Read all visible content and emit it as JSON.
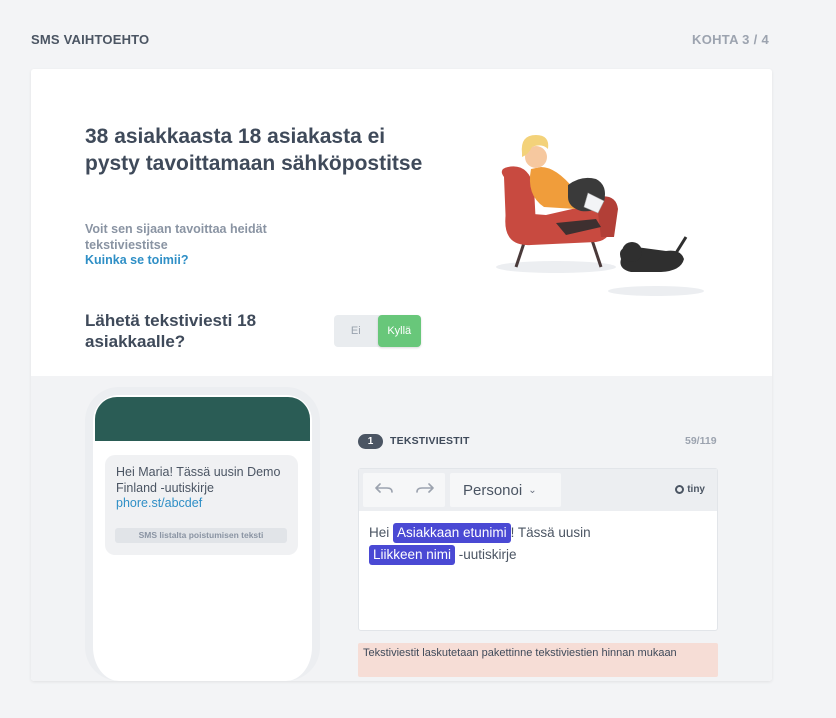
{
  "header": {
    "title": "SMS VAIHTOEHTO",
    "step": "KOHTA 3 / 4"
  },
  "hero": {
    "headline": "38 asiakkaasta 18 asiakasta ei pysty tavoittamaan sähköpostitse",
    "subtext": "Voit sen sijaan tavoittaa heidät tekstiviestitse",
    "help_link": "Kuinka se toimii?"
  },
  "question": {
    "text": "Lähetä tekstiviesti 18 asiakkaalle?",
    "toggle": {
      "no": "Ei",
      "yes": "Kyllä",
      "selected": "Kyllä"
    }
  },
  "preview": {
    "message": "Hei Maria! Tässä uusin Demo Finland -uutiskirje",
    "link": "phore.st/abcdef",
    "optout": "SMS listalta poistumisen teksti"
  },
  "section": {
    "number": "1",
    "title": "TEKSTIVIESTIT",
    "count": "59/119"
  },
  "editor": {
    "personalize": "Personoi",
    "brand": "tiny",
    "text_1": "Hei ",
    "tag_1": "Asiakkaan etunimi",
    "text_2": "! Tässä uusin ",
    "tag_2": "Liikkeen nimi",
    "text_3": " -uutiskirje"
  },
  "notice": "Tekstiviestit laskutetaan pakettinne tekstiviestien hinnan mukaan",
  "colors": {
    "accent_green": "#68c77a",
    "tag_blue": "#4a49d4",
    "phone_header": "#2a5c55",
    "link_blue": "#2f8fc6"
  }
}
